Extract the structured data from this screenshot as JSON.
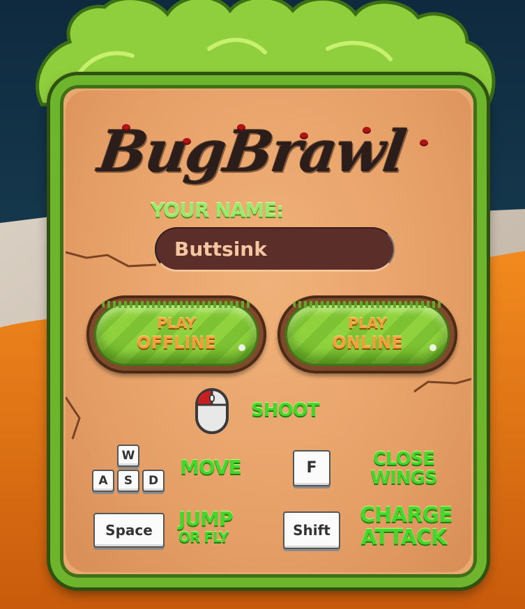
{
  "game": {
    "title": "BugBrawl"
  },
  "name_form": {
    "label": "YOUR NAME:",
    "value": "Buttsink"
  },
  "buttons": {
    "play_offline": {
      "line1": "PLAY",
      "line2": "OFFLINE"
    },
    "play_online": {
      "line1": "PLAY",
      "line2": "ONLINE"
    }
  },
  "controls": {
    "shoot": "SHOOT",
    "move": "MOVE",
    "close_wings_1": "CLOSE",
    "close_wings_2": "WINGS",
    "jump_1": "JUMP",
    "jump_2": "OR FLY",
    "charge_1": "CHARGE",
    "charge_2": "ATTACK"
  },
  "keys": {
    "w": "W",
    "a": "A",
    "s": "S",
    "d": "D",
    "f": "F",
    "space": "Space",
    "shift": "Shift"
  },
  "icons": {
    "shoot": "mouse-left-click-icon"
  },
  "colors": {
    "panel_frame": "#6db52c",
    "panel_fill": "#e9a86f",
    "label_green": "#47d62a",
    "button_text": "#f2a23a",
    "name_field_bg": "#5b2e2a"
  }
}
